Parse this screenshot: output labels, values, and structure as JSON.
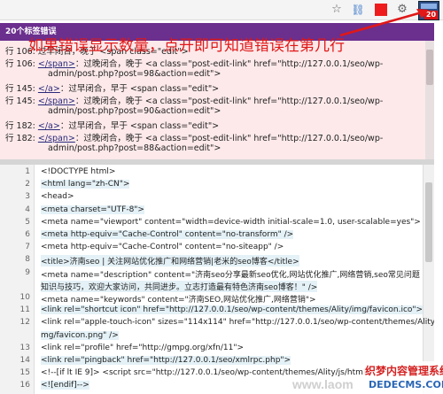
{
  "toolbar": {
    "icons": [
      "star-icon",
      "link-icon",
      "red-square-icon",
      "gear-icon",
      "html-validator-extension-icon"
    ],
    "extension_badge": "20"
  },
  "error_panel": {
    "header": "20个标签错误",
    "lines": [
      {
        "prefix": "行 106:",
        "tag": "",
        "text": "过早闭合，晚于 <span class=\"edit\">"
      },
      {
        "prefix": "行 106:",
        "tag": "</span>",
        "text": "：过晚闭合，晚于 <a class=\"post-edit-link\" href=\"http://127.0.0.1/seo/wp-"
      },
      {
        "prefix": "",
        "tag": "",
        "text": "admin/post.php?post=98&action=edit\">"
      },
      {
        "prefix": "行 145:",
        "tag": "</a>",
        "text": "：过早闭合，早于 <span class=\"edit\">"
      },
      {
        "prefix": "行 145:",
        "tag": "</span>",
        "text": "：过晚闭合，晚于 <a class=\"post-edit-link\" href=\"http://127.0.0.1/seo/wp-"
      },
      {
        "prefix": "",
        "tag": "",
        "text": "admin/post.php?post=90&action=edit\">"
      },
      {
        "prefix": "行 182:",
        "tag": "</a>",
        "text": "：过早闭合，早于 <span class=\"edit\">"
      },
      {
        "prefix": "行 182:",
        "tag": "</span>",
        "text": "：过晚闭合，晚于 <a class=\"post-edit-link\" href=\"http://127.0.0.1/seo/wp-"
      },
      {
        "prefix": "",
        "tag": "",
        "text": "admin/post.php?post=88&action=edit\">"
      }
    ]
  },
  "annotation": "如果错误显示数量，点开即可知道错误在第几行",
  "source": {
    "lines": [
      {
        "n": "1",
        "code": "<!DOCTYPE html>"
      },
      {
        "n": "2",
        "code": "<html lang=\"zh-CN\">"
      },
      {
        "n": "3",
        "code": "<head>"
      },
      {
        "n": "4",
        "code": "<meta charset=\"UTF-8\">"
      },
      {
        "n": "5",
        "code": "<meta name=\"viewport\" content=\"width=device-width initial-scale=1.0, user-scalable=yes\">"
      },
      {
        "n": "6",
        "code": "<meta http-equiv=\"Cache-Control\" content=\"no-transform\" />"
      },
      {
        "n": "7",
        "code": "<meta http-equiv=\"Cache-Control\" content=\"no-siteapp\" />"
      },
      {
        "n": "8",
        "code": "<title>济南seo | 关注网站优化推广和网络营销|老米的seo博客</title>"
      },
      {
        "n": "9",
        "code": "<meta name=\"description\" content=\"济南seo分享最新seo优化,网站优化推广,网络营销,seo常见问题"
      },
      {
        "n": "",
        "code": "知识与技巧，欢迎大家访问，共同进步。立志打造最有特色济南seo博客！\" />"
      },
      {
        "n": "10",
        "code": "<meta name=\"keywords\" content=\"济南SEO,网站优化推广,网络营销\">"
      },
      {
        "n": "11",
        "code": "<link rel=\"shortcut icon\" href=\"http://127.0.0.1/seo/wp-content/themes/Ality/img/favicon.ico\">"
      },
      {
        "n": "12",
        "code": "<link rel=\"apple-touch-icon\" sizes=\"114x114\" href=\"http://127.0.0.1/seo/wp-content/themes/Ality/i"
      },
      {
        "n": "",
        "code": "mg/favicon.png\" />"
      },
      {
        "n": "13",
        "code": "<link rel=\"profile\" href=\"http://gmpg.org/xfn/11\">"
      },
      {
        "n": "14",
        "code": "<link rel=\"pingback\" href=\"http://127.0.0.1/seo/xmlrpc.php\">"
      },
      {
        "n": "15",
        "code": "<!--[if lt IE 9]> <script src=\"http://127.0.0.1/seo/wp-content/themes/Ality/js/html5"
      },
      {
        "n": "16",
        "code": "<![endif]-->"
      }
    ]
  },
  "watermark": {
    "text": "www.laom",
    "badge_line1": "织梦内容管理系统",
    "badge_line2": "DEDECMS.COM"
  }
}
